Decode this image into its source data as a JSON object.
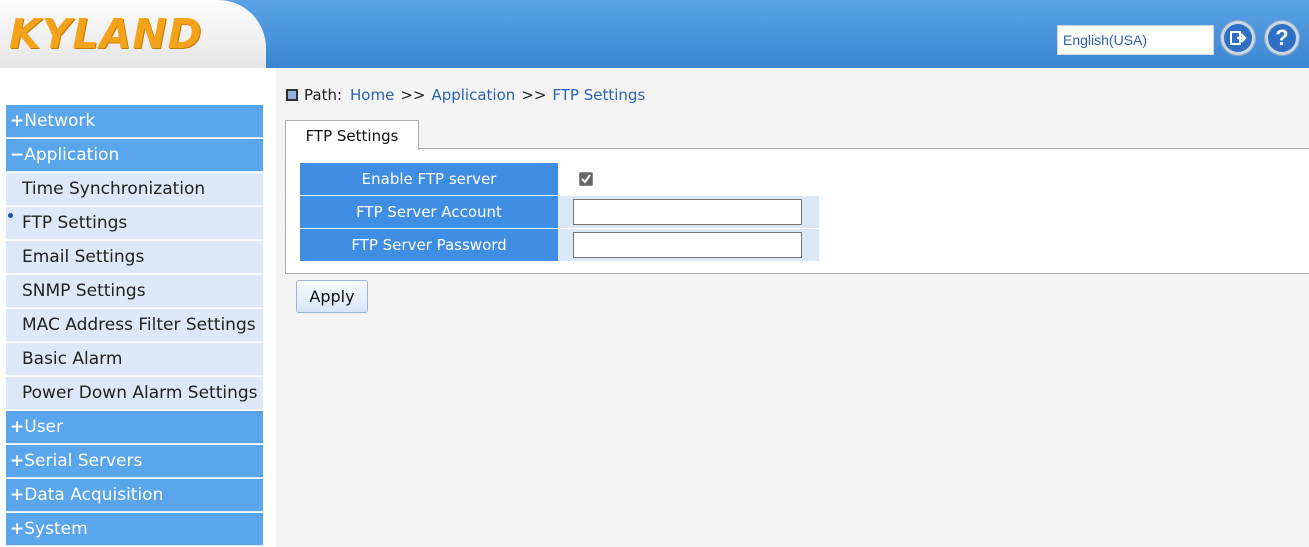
{
  "header": {
    "logo": "KYLAND",
    "language": "English(USA)",
    "logout_icon": "logout-arrow-icon",
    "help_icon": "help-question-icon"
  },
  "sidebar": {
    "items": [
      {
        "type": "category",
        "sign": "+",
        "label": "Network"
      },
      {
        "type": "category",
        "sign": "−",
        "label": "Application"
      },
      {
        "type": "sub",
        "label": "Time Synchronization"
      },
      {
        "type": "sub",
        "label": "FTP Settings",
        "active": true
      },
      {
        "type": "sub",
        "label": "Email Settings"
      },
      {
        "type": "sub",
        "label": "SNMP Settings"
      },
      {
        "type": "sub",
        "label": "MAC Address Filter Settings"
      },
      {
        "type": "sub",
        "label": "Basic Alarm"
      },
      {
        "type": "sub",
        "label": "Power Down Alarm Settings"
      },
      {
        "type": "category",
        "sign": "+",
        "label": "User"
      },
      {
        "type": "category",
        "sign": "+",
        "label": "Serial Servers"
      },
      {
        "type": "category",
        "sign": "+",
        "label": "Data Acquisition"
      },
      {
        "type": "category",
        "sign": "+",
        "label": "System"
      }
    ]
  },
  "breadcrumb": {
    "prefix": "Path:",
    "items": [
      "Home",
      "Application",
      "FTP Settings"
    ],
    "separator": ">>"
  },
  "tab": {
    "label": "FTP Settings"
  },
  "form": {
    "enable_label": "Enable FTP server",
    "enable_checked": true,
    "account_label": "FTP Server Account",
    "account_value": "",
    "password_label": "FTP Server Password",
    "password_value": ""
  },
  "apply_label": "Apply",
  "colors": {
    "header_blue": "#3c86d3",
    "menu_category": "#5aa6ec",
    "menu_sub": "#dce9f8",
    "label_blue": "#3f8ee3",
    "logo_orange": "#f3a21a"
  }
}
